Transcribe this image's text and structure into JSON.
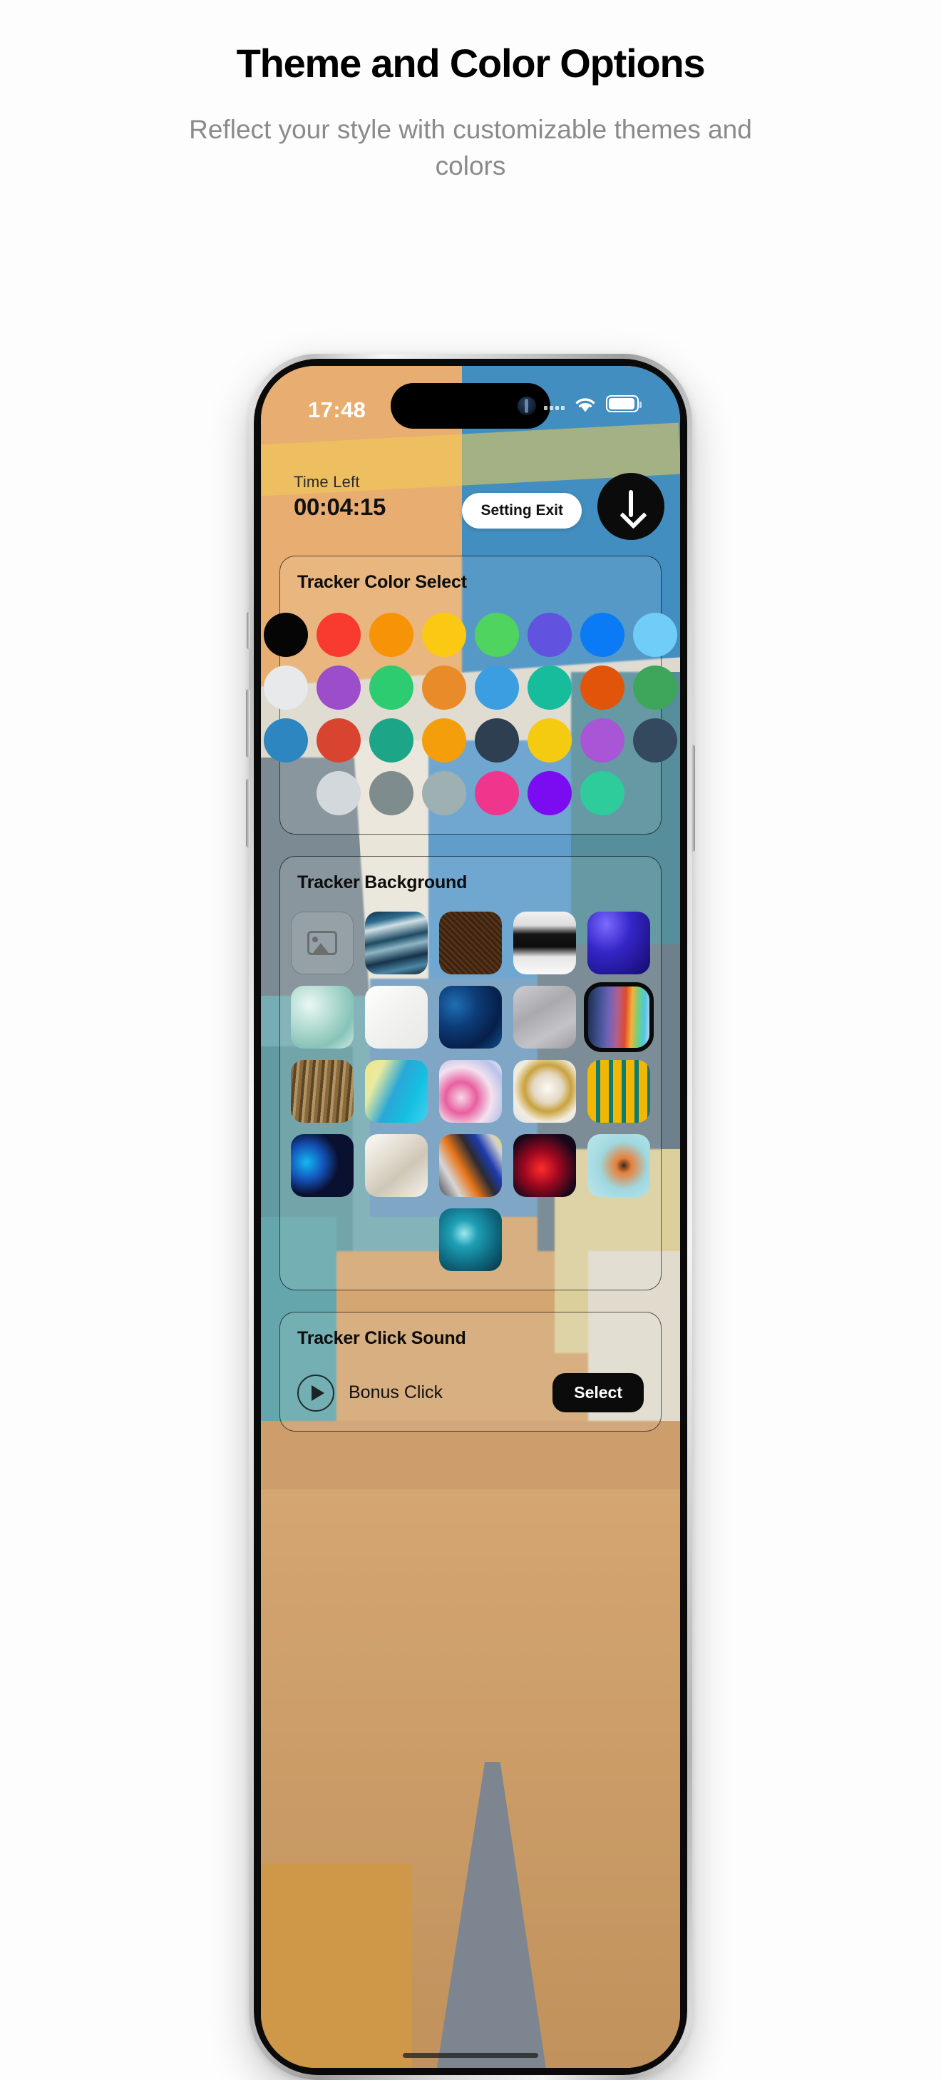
{
  "promo": {
    "title": "Theme and Color Options",
    "subtitle": "Reflect your style with customizable themes and colors"
  },
  "status_bar": {
    "time": "17:48",
    "wifi_icon": "wifi-icon",
    "battery_icon": "battery-icon",
    "signal_icon": "signal-dots-icon"
  },
  "app_bar": {
    "time_left_label": "Time Left",
    "time_left_value": "00:04:15",
    "setting_exit_label": "Setting Exit",
    "collapse_icon": "arrow-down-icon"
  },
  "color_section": {
    "title": "Tracker Color Select",
    "rows": [
      [
        {
          "name": "black",
          "hex": "#050505"
        },
        {
          "name": "red",
          "hex": "#F93B2F"
        },
        {
          "name": "orange",
          "hex": "#F79306"
        },
        {
          "name": "yellow",
          "hex": "#FBC913"
        },
        {
          "name": "green",
          "hex": "#4ED45F"
        },
        {
          "name": "indigo",
          "hex": "#6152E0"
        },
        {
          "name": "blue",
          "hex": "#0A7BF5"
        },
        {
          "name": "light-blue",
          "hex": "#6FCDF7"
        }
      ],
      [
        {
          "name": "white",
          "hex": "#E8E9EB"
        },
        {
          "name": "purple",
          "hex": "#9B4DCA"
        },
        {
          "name": "emerald",
          "hex": "#2ECC71"
        },
        {
          "name": "amber-orange",
          "hex": "#E98B28"
        },
        {
          "name": "sky-blue",
          "hex": "#3B9EE0"
        },
        {
          "name": "teal",
          "hex": "#17BC9C"
        },
        {
          "name": "dark-orange",
          "hex": "#E0550A"
        },
        {
          "name": "leaf-green",
          "hex": "#3EA65A"
        }
      ],
      [
        {
          "name": "steel-blue",
          "hex": "#2E86C1"
        },
        {
          "name": "brick-red",
          "hex": "#D94431"
        },
        {
          "name": "sea-green",
          "hex": "#1DA588"
        },
        {
          "name": "marigold",
          "hex": "#F59E0B"
        },
        {
          "name": "navy-slate",
          "hex": "#2F3F52"
        },
        {
          "name": "gold",
          "hex": "#F5CB12"
        },
        {
          "name": "orchid",
          "hex": "#A855D6"
        },
        {
          "name": "dark-slate",
          "hex": "#34495E"
        }
      ],
      [
        {
          "name": "light-gray",
          "hex": "#D3D8DC"
        },
        {
          "name": "gray",
          "hex": "#7F8C8D"
        },
        {
          "name": "blue-gray",
          "hex": "#9FB0B3"
        },
        {
          "name": "pink",
          "hex": "#F0368C"
        },
        {
          "name": "violet",
          "hex": "#7B0BF0"
        },
        {
          "name": "mint",
          "hex": "#2ECC9B"
        }
      ]
    ]
  },
  "background_section": {
    "title": "Tracker Background",
    "placeholder_icon": "image-placeholder-icon",
    "selected_index": 9,
    "rows": [
      [
        {
          "name": "custom-image-placeholder",
          "kind": "placeholder"
        },
        {
          "name": "blue-waves",
          "css": "linear-gradient(168deg,#123046 0%,#2e6d91 16%,#cfe0e6 26%,#1d4a63 44%,#8fb6c4 56%,#15334a 72%,#4d87a5 86%,#0d2334 100%)"
        },
        {
          "name": "brown-fabric",
          "css": "repeating-linear-gradient(45deg,#3b2310 0 3px,#56341a 3px 6px),radial-gradient(circle,#4a2c14,#2e1a0a)"
        },
        {
          "name": "black-white-clouds",
          "css": "linear-gradient(180deg,#f2f2f2 0%,#dcdcdc 22%,#141414 36%,#0d0d0d 56%,#e6e6e6 72%,#fafafa 100%)"
        },
        {
          "name": "purple-blue-gradient",
          "css": "radial-gradient(ellipse at 30% 20%,#7b6bff 0%,#3426c7 40%,#140a6b 100%),linear-gradient(120deg,#241bb0,#5a3df0)"
        }
      ],
      [
        {
          "name": "turquoise-water",
          "css": "radial-gradient(circle at 30% 30%,#eaf7f3 0%,#b8ded4 35%,#87c3b7 70%,#cfe9e1 100%)"
        },
        {
          "name": "white-texture",
          "css": "linear-gradient(135deg,#ffffff 0%,#f2f2f0 45%,#e8e8e6 100%)"
        },
        {
          "name": "blue-marble",
          "css": "radial-gradient(circle at 25% 30%,#1f6fb5 0%,#0d3c77 35%,#071f4a 70%,#12528f 100%)"
        },
        {
          "name": "gray-concrete",
          "css": "linear-gradient(150deg,#cfcfd2 0%,#a9a9ae 40%,#c4c4c8 70%,#9b9ba1 100%)"
        },
        {
          "name": "rainbow-gradient",
          "css": "linear-gradient(92deg,#1b2b4a 0%,#3c4f8c 18%,#6d63b8 34%,#b25f8f 48%,#e04a2a 60%,#f0b33c 70%,#6fd080 80%,#4fc5e8 90%,#cfd6ee 100%)"
        }
      ],
      [
        {
          "name": "tree-bark",
          "css": "repeating-linear-gradient(95deg,#8a6a3c 0 5px,#5d4423 5px 9px,#b19463 9px 13px)"
        },
        {
          "name": "cyan-yellow-marble",
          "css": "linear-gradient(115deg,#f5e58a 0%,#e8eaa0 22%,#2aa7d6 48%,#14bfe0 72%,#40d2ef 100%)"
        },
        {
          "name": "pink-marble",
          "css": "radial-gradient(circle at 35% 60%,#f8d7e6 0%,#e85fa0 28%,#f3e2ee 55%,#b9c2ea 80%,#fdf4f9 100%)"
        },
        {
          "name": "gold-white-marble",
          "css": "radial-gradient(circle at 55% 45%,#fdfaf3 0%,#e3d8c4 30%,#c9a23c 48%,#f2ece0 70%,#d9e1ea 100%)"
        },
        {
          "name": "yellow-teal-paint",
          "css": "repeating-linear-gradient(90deg,#f2b705 0 12px,#0e7a72 12px 18px),linear-gradient(180deg,#0e7a72 0 20%,#f2b705 20% 100%)"
        }
      ],
      [
        {
          "name": "blue-red-smoke",
          "css": "radial-gradient(circle at 25% 45%,#12b9f0 0%,#1452b8 30%,#0a1030 55%),radial-gradient(circle at 80% 35%,#ff3a2a 0%,#8a1038 35%,#0a1030 70%)"
        },
        {
          "name": "white-crumpled",
          "css": "linear-gradient(140deg,#fbfaf7 0%,#e4ded2 35%,#cfc6b6 60%,#f5f2ec 100%)"
        },
        {
          "name": "abstract-geometric",
          "css": "linear-gradient(60deg,#4a4a50 0%,#d6d6d6 22%,#e8751a 40%,#2b2b33 58%,#1d3bb0 72%,#cfcfcf 88%,#f2e14a 100%)"
        },
        {
          "name": "red-ink",
          "css": "radial-gradient(circle at 45% 55%,#ff2d2d 0%,#a1081f 35%,#17071a 75%)"
        },
        {
          "name": "turquoise-orange",
          "css": "radial-gradient(circle at 58% 50%,#3a2a20 0%,#e8803a 16%,#9fd8e0 50%,#bfe6ec 100%)"
        }
      ],
      [
        {
          "name": "teal-starfield",
          "css": "radial-gradient(circle at 40% 40%,#9fe8ef 0%,#1f9fb5 25%,#0d6a80 60%,#07323f 100%)"
        }
      ]
    ]
  },
  "sound_section": {
    "title": "Tracker Click Sound",
    "play_icon": "play-circle-icon",
    "sound_name": "Bonus Click",
    "select_label": "Select"
  }
}
